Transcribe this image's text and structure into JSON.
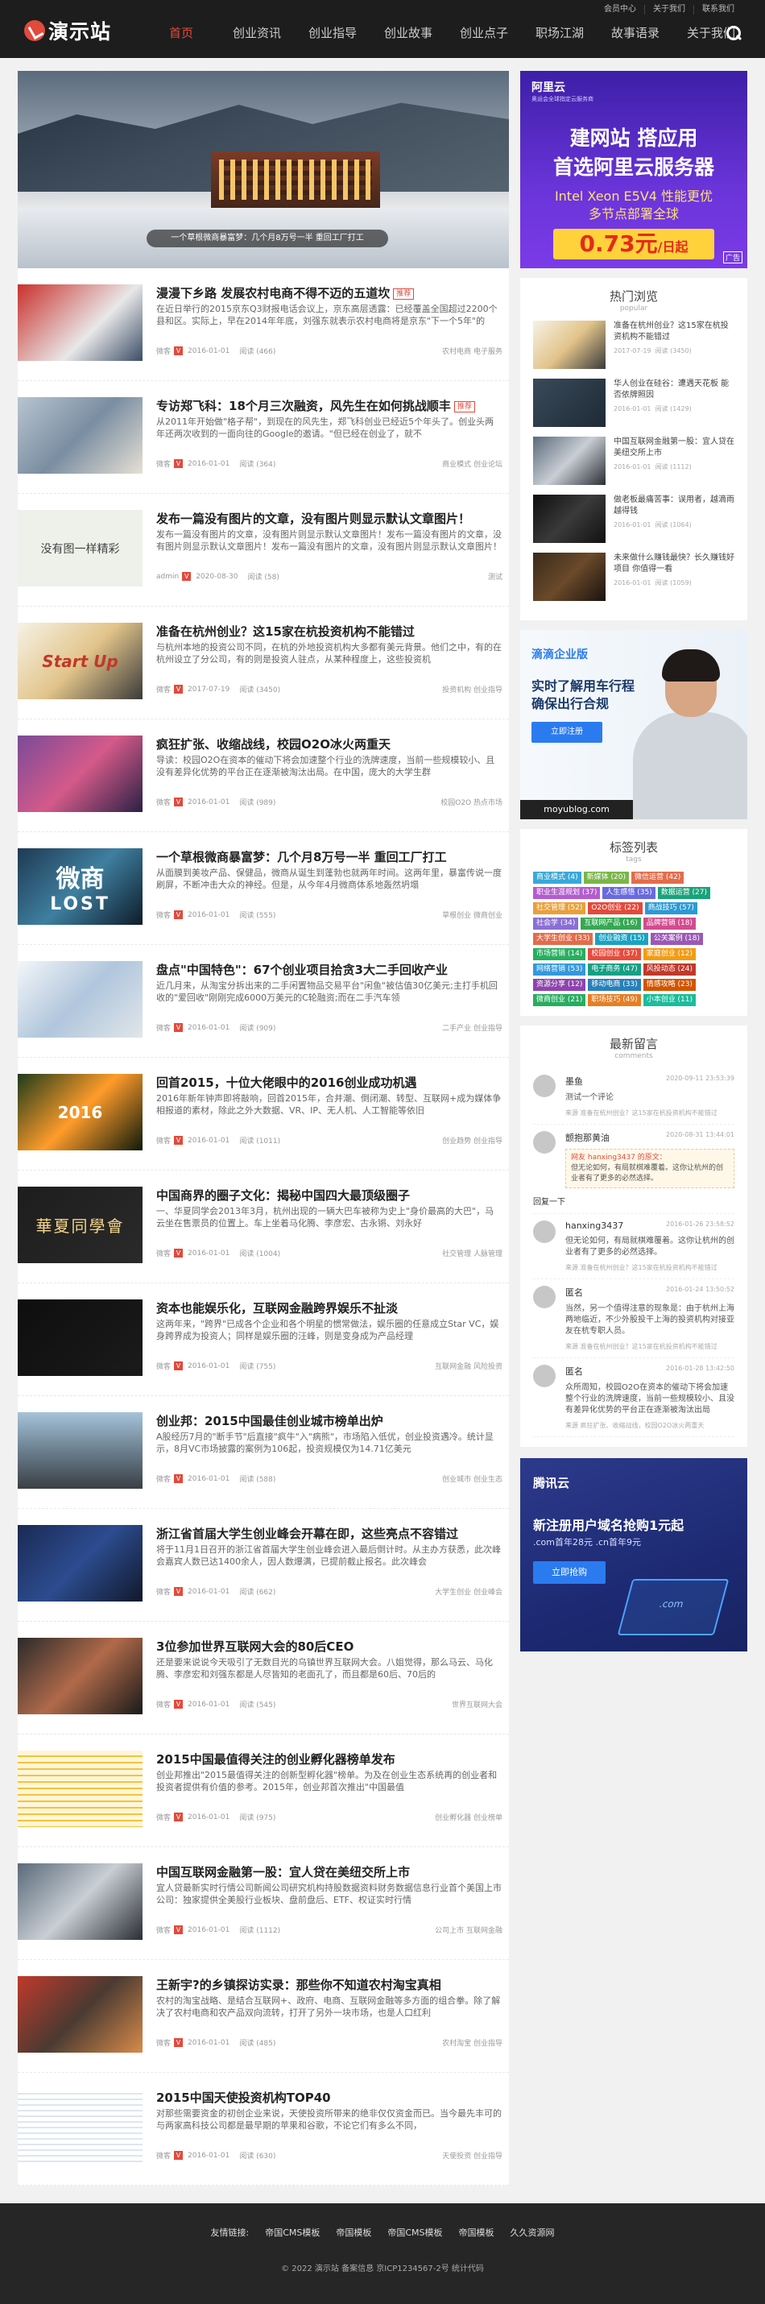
{
  "topbar": {
    "links": [
      "会员中心",
      "关于我们",
      "联系我们"
    ]
  },
  "logo": {
    "text": "演示站"
  },
  "nav": [
    "首页",
    "创业资讯",
    "创业指导",
    "创业故事",
    "创业点子",
    "职场江湖",
    "故事语录",
    "关于我们"
  ],
  "slider": {
    "caption": "一个草根微商暴富梦：几个月8万号一半 重回工厂打工"
  },
  "posts": [
    {
      "title": "漫漫下乡路 发展农村电商不得不迈的五道坎",
      "badge": "推荐",
      "excerpt": "在近日举行的2015京东Q3财报电话会议上，京东高层透露：已经覆盖全国超过2200个县和区。实际上，早在2014年年底，刘强东就表示农村电商将是京东\"下一个5年\"的",
      "author": "微客",
      "date": "2016-01-01",
      "views": "阅读 (466)",
      "tags": "农村电商 电子服务"
    },
    {
      "title": "专访郑飞科：18个月三次融资，风先生在如何挑战顺丰",
      "badge": "推荐",
      "excerpt": "从2011年开始做\"格子帮\"，到现在的风先生，郑飞科创业已经近5个年头了。创业头两年还两次收到的一面向往的Google的邀请。\"但已经在创业了，就不",
      "author": "微客",
      "date": "2016-01-01",
      "views": "阅读 (364)",
      "tags": "商业模式 创业论坛"
    },
    {
      "title": "发布一篇没有图片的文章，没有图片则显示默认文章图片！",
      "badge": "",
      "excerpt": "发布一篇没有图片的文章，没有图片则显示默认文章图片！发布一篇没有图片的文章，没有图片则显示默认文章图片！发布一篇没有图片的文章，没有图片则显示默认文章图片！",
      "author": "admin",
      "date": "2020-08-30",
      "views": "阅读 (58)",
      "tags": "测试"
    },
    {
      "title": "准备在杭州创业？这15家在杭投资机构不能错过",
      "badge": "",
      "excerpt": "与杭州本地的投资公司不同，在杭的外地投资机构大多都有美元背景。他们之中，有的在杭州设立了分公司，有的则是投资人驻点，从某种程度上，这些投资机",
      "author": "微客",
      "date": "2017-07-19",
      "views": "阅读 (3450)",
      "tags": "投资机构 创业指导"
    },
    {
      "title": "疯狂扩张、收缩战线，校园O2O冰火两重天",
      "badge": "",
      "excerpt": "导读：校园O2O在资本的催动下将会加速整个行业的洗牌速度，当前一些规模较小、且没有差异化优势的平台正在逐渐被淘汰出局。在中国，庞大的大学生群",
      "author": "微客",
      "date": "2016-01-01",
      "views": "阅读 (989)",
      "tags": "校园O2O 热点市场"
    },
    {
      "title": "一个草根微商暴富梦：几个月8万号一半 重回工厂打工",
      "badge": "",
      "excerpt": "从面膜到美妆产品、保健品，微商从诞生到蓬勃也就两年时间。这两年里，暴富传说一度刷屏，不断冲击大众的神经。但是，从今年4月微商体系地轰然坍塌",
      "author": "微客",
      "date": "2016-01-01",
      "views": "阅读 (555)",
      "tags": "草根创业 微商创业"
    },
    {
      "title": "盘点\"中国特色\"：67个创业项目拾贪3大二手回收产业",
      "badge": "",
      "excerpt": "近几月来，从淘宝分拆出来的二手闲置物品交易平台\"闲鱼\"被估值30亿美元;主打手机回收的\"爱回收\"刚刚完成6000万美元的C轮融资;而在二手汽车领",
      "author": "微客",
      "date": "2016-01-01",
      "views": "阅读 (909)",
      "tags": "二手产业 创业指导"
    },
    {
      "title": "回首2015，十位大佬眼中的2016创业成功机遇",
      "badge": "",
      "excerpt": "2016年新年钟声即将敲响，回首2015年，合并潮、倒闭潮、转型、互联网+成为媒体争相报道的素材，除此之外大数据、VR、IP、无人机、人工智能等依旧",
      "author": "微客",
      "date": "2016-01-01",
      "views": "阅读 (1011)",
      "tags": "创业趋势 创业指导"
    },
    {
      "title": "中国商界的圈子文化：揭秘中国四大最顶级圈子",
      "badge": "",
      "excerpt": "一、华夏同学会2013年3月，杭州出现的一辆大巴车被称为史上\"身价最高的大巴\"，马云坐在售票员的位置上。车上坐着马化腾、李彦宏、古永锵、刘永好",
      "author": "微客",
      "date": "2016-01-01",
      "views": "阅读 (1004)",
      "tags": "社交管理 人脉管理"
    },
    {
      "title": "资本也能娱乐化，互联网金融跨界娱乐不扯淡",
      "badge": "",
      "excerpt": "这两年来，\"跨界\"已成各个企业和各个明星的惯常做法，娱乐圈的任意成立Star VC，娱身跨界成为投资人；同样是娱乐圈的汪峰，则是变身成为产品经理",
      "author": "微客",
      "date": "2016-01-01",
      "views": "阅读 (755)",
      "tags": "互联网金融 风险投资"
    },
    {
      "title": "创业邦：2015中国最佳创业城市榜单出炉",
      "badge": "",
      "excerpt": "A股经历7月的\"断手节\"后直接\"疯牛\"入\"病熊\"，市场陷入低优，创业投资遇冷。统计显示，8月VC市场披露的案例为106起，投资规模仅为14.71亿美元",
      "author": "微客",
      "date": "2016-01-01",
      "views": "阅读 (588)",
      "tags": "创业城市 创业生态"
    },
    {
      "title": "浙江省首届大学生创业峰会开幕在即，这些亮点不容错过",
      "badge": "",
      "excerpt": "将于11月1日召开的浙江省首届大学生创业峰会进入最后倒计时。从主办方获悉，此次峰会嘉宾人数已达1400余人，因人数爆满，已提前截止报名。此次峰会",
      "author": "微客",
      "date": "2016-01-01",
      "views": "阅读 (662)",
      "tags": "大学生创业 创业峰会"
    },
    {
      "title": "3位参加世界互联网大会的80后CEO",
      "badge": "",
      "excerpt": "还是要来说说今天吸引了无数目光的乌镇世界互联网大会。八姐觉得，那么马云、马化腾、李彦宏和刘强东都是人尽皆知的老面孔了，而且都是60后、70后的",
      "author": "微客",
      "date": "2016-01-01",
      "views": "阅读 (545)",
      "tags": "世界互联网大会"
    },
    {
      "title": "2015中国最值得关注的创业孵化器榜单发布",
      "badge": "",
      "excerpt": "创业邦推出\"2015最值得关注的创新型孵化器\"榜单。为及在创业生态系统再的创业者和投资者提供有价值的参考。2015年，创业邦首次推出\"中国最值",
      "author": "微客",
      "date": "2016-01-01",
      "views": "阅读 (975)",
      "tags": "创业孵化器 创业榜单"
    },
    {
      "title": "中国互联网金融第一股：宜人贷在美纽交所上市",
      "badge": "",
      "excerpt": "宜人贷最新实时行情公司新闻公司研究机构持股数据资料财务数据信息行业首个美国上市公司：独家提供全美股行业板块、盘前盘后、ETF、权证实时行情",
      "author": "微客",
      "date": "2016-01-01",
      "views": "阅读 (1112)",
      "tags": "公司上市 互联网金融"
    },
    {
      "title": "王新宇?的乡镇探访实录：那些你不知道农村淘宝真相",
      "badge": "",
      "excerpt": "农村的淘宝战略、是结合互联网+、政府、电商、互联网金融等多方面的组合拳。除了解决了农村电商和农产品双向流转，打开了另外一块市场，也是人口红利",
      "author": "微客",
      "date": "2016-01-01",
      "views": "阅读 (485)",
      "tags": "农村淘宝 创业指导"
    },
    {
      "title": "2015中国天使投资机构TOP40",
      "badge": "",
      "excerpt": "对那些需要资金的初创企业来说，天使投资所带来的绝非仅仅资金而已。当今最先丰可的与两家高科技公司都是最早期的苹果和谷歌，不论它们有多么不同，",
      "author": "微客",
      "date": "2016-01-01",
      "views": "阅读 (630)",
      "tags": "天使投资 创业指导"
    }
  ],
  "default_thumb_text": "没有图一样精彩",
  "ad_aliyun": {
    "brand": "阿里云",
    "brandsub": "奥运会全球指定云服务商",
    "line1": "建网站 搭应用",
    "line2": "首选阿里云服务器",
    "line3": "Intel Xeon E5V4 性能更优",
    "line4": "多节点部署全球",
    "price": "0.73元",
    "unit": "/日起",
    "ad_mark": "广告"
  },
  "hot": {
    "title": "热门浏览",
    "sub": "popular",
    "items": [
      {
        "title": "准备在杭州创业？这15家在杭投资机构不能错过",
        "date": "2017-07-19",
        "views": "阅读 (3450)"
      },
      {
        "title": "华人创业在硅谷：遭遇天花板 能否依牌照因",
        "date": "2016-01-01",
        "views": "阅读 (1429)"
      },
      {
        "title": "中国互联网金融第一股：宜人贷在美纽交所上市",
        "date": "2016-01-01",
        "views": "阅读 (1112)"
      },
      {
        "title": "做老板最痛苦事：误用者，越滴雨越得钱",
        "date": "2016-01-01",
        "views": "阅读 (1064)"
      },
      {
        "title": "未来做什么赚钱最快？长久赚钱好项目 你值得一看",
        "date": "2016-01-01",
        "views": "阅读 (1059)"
      }
    ]
  },
  "ad_didi": {
    "brand": "滴滴企业版",
    "line1": "实时了解用车行程",
    "line2": "确保出行合规",
    "btn": "立即注册",
    "watermark": "moyublog.com"
  },
  "tags": {
    "title": "标签列表",
    "sub": "tags",
    "items": [
      {
        "label": "商业模式 (4)",
        "color": "#3aa8d8"
      },
      {
        "label": "新媒体 (20)",
        "color": "#7ab648"
      },
      {
        "label": "微信运营 (42)",
        "color": "#e26c4b"
      },
      {
        "label": "职业生涯规划 (37)",
        "color": "#b35ccf"
      },
      {
        "label": "人生感悟 (35)",
        "color": "#6a6ae0"
      },
      {
        "label": "数据运营 (27)",
        "color": "#1aa37a"
      },
      {
        "label": "社交管理 (52)",
        "color": "#e9a03b"
      },
      {
        "label": "O2O创业 (22)",
        "color": "#e24a3b"
      },
      {
        "label": "商战技巧 (57)",
        "color": "#2b9ad6"
      },
      {
        "label": "社会学 (34)",
        "color": "#8a6fd4"
      },
      {
        "label": "互联网产品 (16)",
        "color": "#36a853"
      },
      {
        "label": "品牌营销 (18)",
        "color": "#d24c8d"
      },
      {
        "label": "大学生创业 (33)",
        "color": "#e26c4b"
      },
      {
        "label": "创业融资 (15)",
        "color": "#1aa3c2"
      },
      {
        "label": "公关案例 (18)",
        "color": "#9b59b6"
      },
      {
        "label": "市场营销 (14)",
        "color": "#27ae60"
      },
      {
        "label": "校园创业 (37)",
        "color": "#e74c3c"
      },
      {
        "label": "家庭创业 (12)",
        "color": "#f39c12"
      },
      {
        "label": "网络营销 (53)",
        "color": "#3498db"
      },
      {
        "label": "电子商务 (47)",
        "color": "#16a085"
      },
      {
        "label": "风投动态 (24)",
        "color": "#c0392b"
      },
      {
        "label": "资源分享 (12)",
        "color": "#8e44ad"
      },
      {
        "label": "移动电商 (33)",
        "color": "#2980b9"
      },
      {
        "label": "情感攻略 (23)",
        "color": "#d35400"
      },
      {
        "label": "微商创业 (21)",
        "color": "#27ae60"
      },
      {
        "label": "职场技巧 (49)",
        "color": "#e67e22"
      },
      {
        "label": "小本创业 (11)",
        "color": "#1abc9c"
      }
    ]
  },
  "comments": {
    "title": "最新留言",
    "sub": "comments",
    "items": [
      {
        "name": "墨鱼",
        "date": "2020-09-11 23:53:39",
        "text": "测试一个评论",
        "src": "来源 准备在杭州创业？这15家在杭投资机构不能错过",
        "quote": "",
        "reply": ""
      },
      {
        "name": "颤抱那黄油",
        "date": "2020-08-31 13:44:01",
        "text": "",
        "src": "",
        "quote_name": "网友 hanxing3437 的原文：",
        "quote": "但无论如何，有局就棋难覆着。这你让杭州的创业者有了更多的必然选择。",
        "reply": "回复一下"
      },
      {
        "name": "hanxing3437",
        "date": "2016-01-26 23:58:52",
        "text": "但无论如何，有局就棋难覆着。这你让杭州的创业者有了更多的必然选择。",
        "src": "来源 准备在杭州创业？这15家在杭投资机构不能错过",
        "quote": "",
        "reply": ""
      },
      {
        "name": "匿名",
        "date": "2016-01-24 13:50:52",
        "text": "当然，另一个值得注意的现象是：由于杭州上海两地临近，不少外股投干上海的投资机构对接亚友在杭专职人员。",
        "src": "来源 准备在杭州创业？这15家在杭投资机构不能错过",
        "quote": "",
        "reply": ""
      },
      {
        "name": "匿名",
        "date": "2016-01-28 13:42:50",
        "text": "众所周知，校园O2O在资本的催动下将会加速整个行业的洗牌速度，当前一些规模较小、且没有差异化优势的平台正在逐渐被淘汰出局",
        "src": "来源 疯狂扩张、收缩战线，校园O2O冰火两重天",
        "quote": "",
        "reply": ""
      }
    ]
  },
  "ad_tencent": {
    "brand": "腾讯云",
    "line1": "新注册用户域名抢购1元起",
    "line2": ".com首年28元 .cn首年9元",
    "btn": "立即抢购"
  },
  "footer": {
    "label": "友情链接:",
    "links": [
      "帝国CMS模板",
      "帝国模板",
      "帝国CMS模板",
      "帝国模板",
      "久久资源网"
    ],
    "copyright": "© 2022 演示站 备案信息 京ICP1234567-2号 统计代码"
  }
}
